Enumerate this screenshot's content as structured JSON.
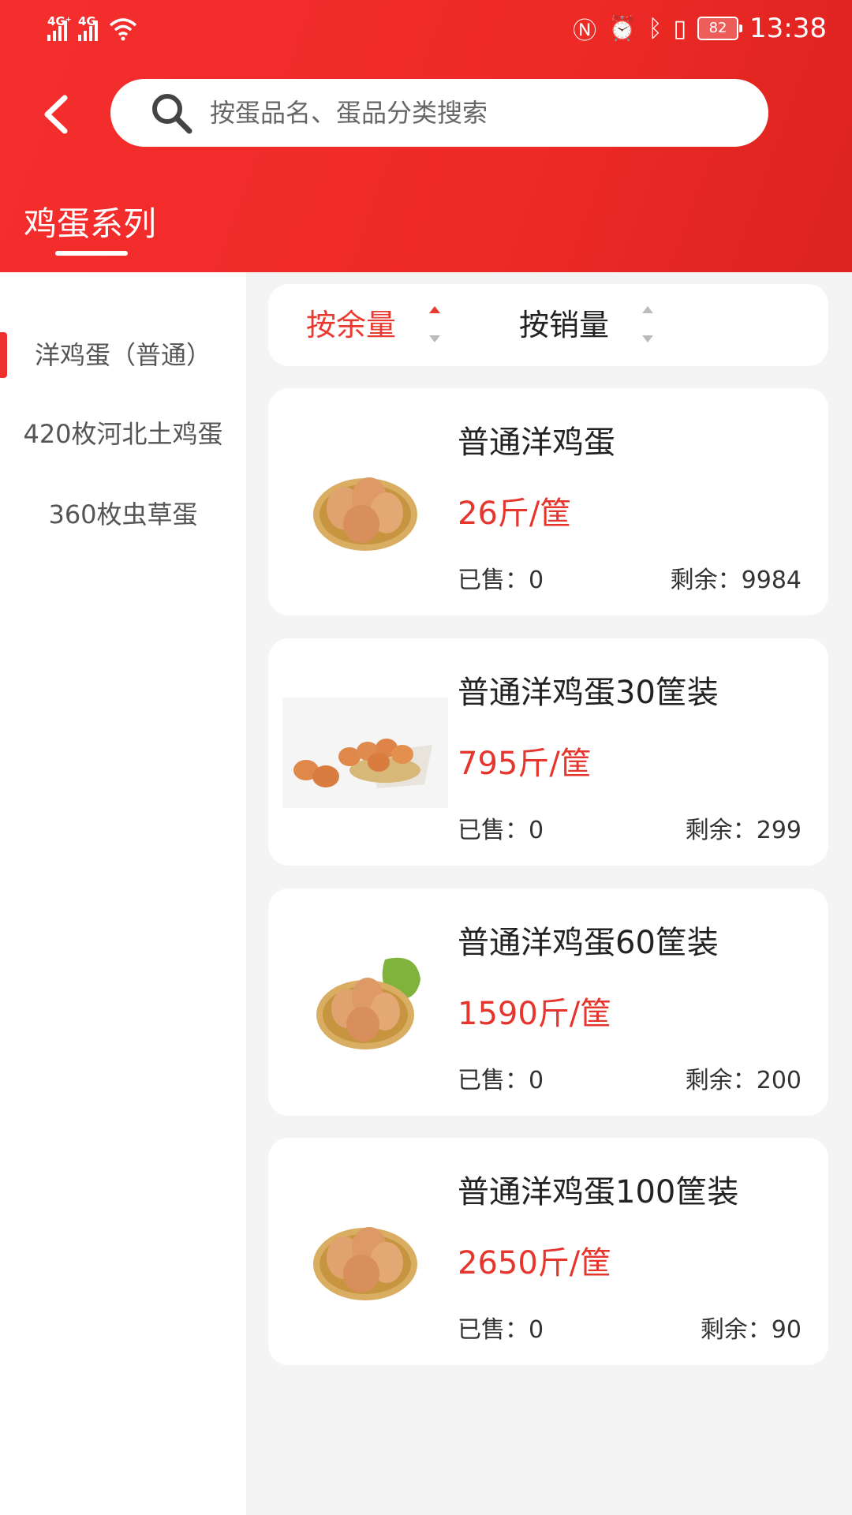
{
  "status_bar": {
    "signal1_label": "4G⁺",
    "signal2_label": "4G",
    "battery": "82",
    "time": "13:38"
  },
  "search": {
    "placeholder": "按蛋品名、蛋品分类搜索"
  },
  "category_tab": "鸡蛋系列",
  "sidebar": {
    "items": [
      {
        "label": "洋鸡蛋（普通）"
      },
      {
        "label": "420枚河北土鸡蛋"
      },
      {
        "label": "360枚虫草蛋"
      }
    ]
  },
  "sort": {
    "by_stock": "按余量",
    "by_sales": "按销量"
  },
  "products": [
    {
      "name": "普通洋鸡蛋",
      "price": "26斤/筐",
      "sold": "已售：0",
      "remain": "剩余：9984"
    },
    {
      "name": "普通洋鸡蛋30筐装",
      "price": "795斤/筐",
      "sold": "已售：0",
      "remain": "剩余：299"
    },
    {
      "name": "普通洋鸡蛋60筐装",
      "price": "1590斤/筐",
      "sold": "已售：0",
      "remain": "剩余：200"
    },
    {
      "name": "普通洋鸡蛋100筐装",
      "price": "2650斤/筐",
      "sold": "已售：0",
      "remain": "剩余：90"
    }
  ],
  "colors": {
    "brand_red": "#f0302e",
    "price_red": "#e6352d"
  }
}
